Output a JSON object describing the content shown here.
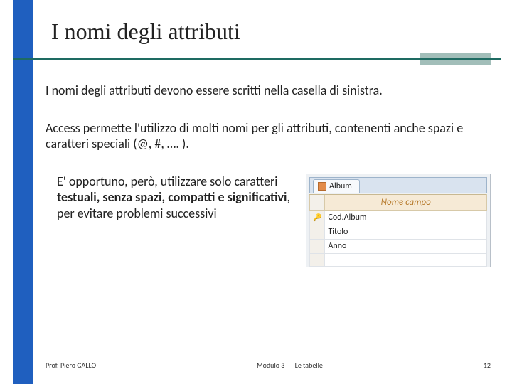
{
  "title": "I nomi degli attributi",
  "paragraphs": {
    "p1": "I nomi degli attributi devono essere scritti nella casella di sinistra.",
    "p2": "Access permette l'utilizzo di molti nomi per gli attributi, contenenti anche spazi e caratteri speciali (@, #, …. ).",
    "p3_pre": "E' opportuno, però, utilizzare solo caratteri ",
    "p3_bold": "testuali, senza spazi, compatti e significativi",
    "p3_post": ", per evitare problemi successivi"
  },
  "access_window": {
    "tab_label": "Album",
    "header": "Nome campo",
    "rows": [
      "Cod.Album",
      "Titolo",
      "Anno"
    ],
    "primary_key_row": 0
  },
  "footer": {
    "author": "Prof. Piero GALLO",
    "module": "Modulo 3",
    "subject": "Le tabelle",
    "page": "12"
  }
}
